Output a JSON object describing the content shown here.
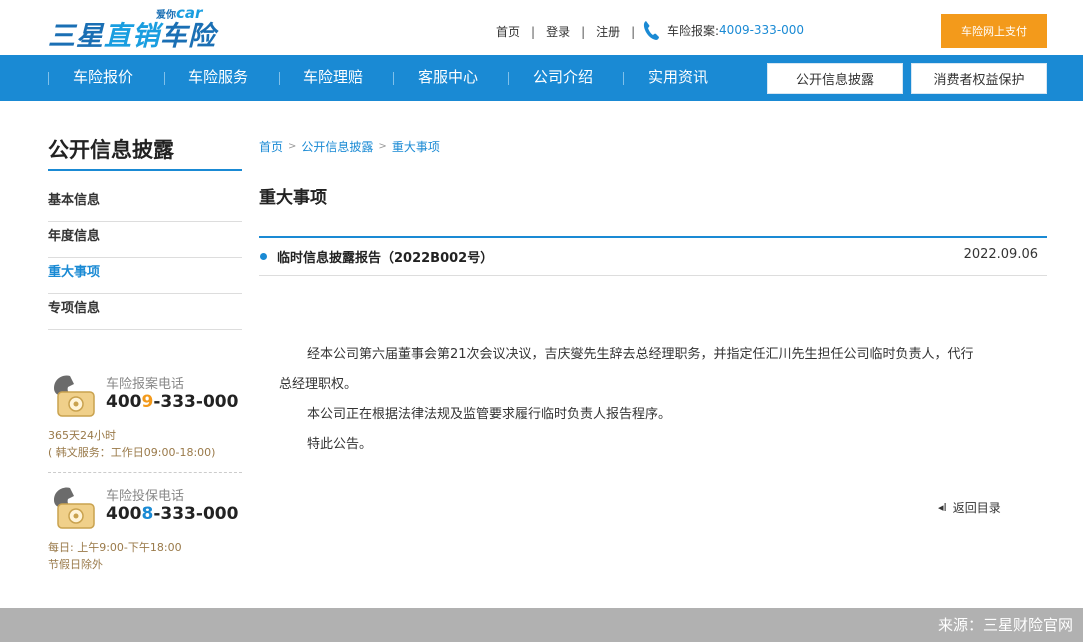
{
  "header": {
    "logo": {
      "main_a": "三星",
      "main_b": "直销",
      "main_c": "车险",
      "sub": "爱你",
      "sub_car": "car"
    },
    "links": [
      "首页",
      "登录",
      "注册"
    ],
    "separator": "|",
    "hotline_label": "车险报案:",
    "hotline_number": "4009-333-000",
    "pay_button": "车险网上支付"
  },
  "nav": {
    "items": [
      "车险报价",
      "车险服务",
      "车险理赔",
      "客服中心",
      "公司介绍",
      "实用资讯"
    ],
    "buttons": [
      "公开信息披露",
      "消费者权益保护"
    ]
  },
  "sidebar": {
    "title": "公开信息披露",
    "items": [
      {
        "label": "基本信息",
        "active": false
      },
      {
        "label": "年度信息",
        "active": false
      },
      {
        "label": "重大事项",
        "active": true
      },
      {
        "label": "专项信息",
        "active": false
      }
    ],
    "contacts": [
      {
        "label": "车险报案电话",
        "num_a": "400",
        "num_hl": "9",
        "num_b": "-333-000",
        "notes": [
          "365天24小时",
          "( 韩文服务：工作日09:00-18:00)"
        ]
      },
      {
        "label": "车险投保电话",
        "num_a": "400",
        "num_hl": "8",
        "num_b": "-333-000",
        "notes": [
          "每日: 上午9:00-下午18:00",
          "节假日除外"
        ]
      }
    ]
  },
  "breadcrumb": [
    "首页",
    "公开信息披露",
    "重大事项"
  ],
  "breadcrumb_separator": ">",
  "main": {
    "title": "重大事项",
    "article_title": "临时信息披露报告（2022B002号）",
    "article_date": "2022.09.06",
    "paragraphs": [
      "经本公司第六届董事会第21次会议决议，吉庆燮先生辞去总经理职务，并指定任汇川先生担任公司临时负责人，代行",
      "总经理职权。",
      "本公司正在根据法律法规及监管要求履行临时负责人报告程序。",
      "特此公告。"
    ],
    "back_link": "返回目录",
    "back_icon": "◂I"
  },
  "footer": {
    "source": "来源：三星财险官网"
  },
  "colors": {
    "brand_blue": "#1a8ad4",
    "orange": "#f39a1b",
    "footer_gray": "#b1b1b1"
  }
}
